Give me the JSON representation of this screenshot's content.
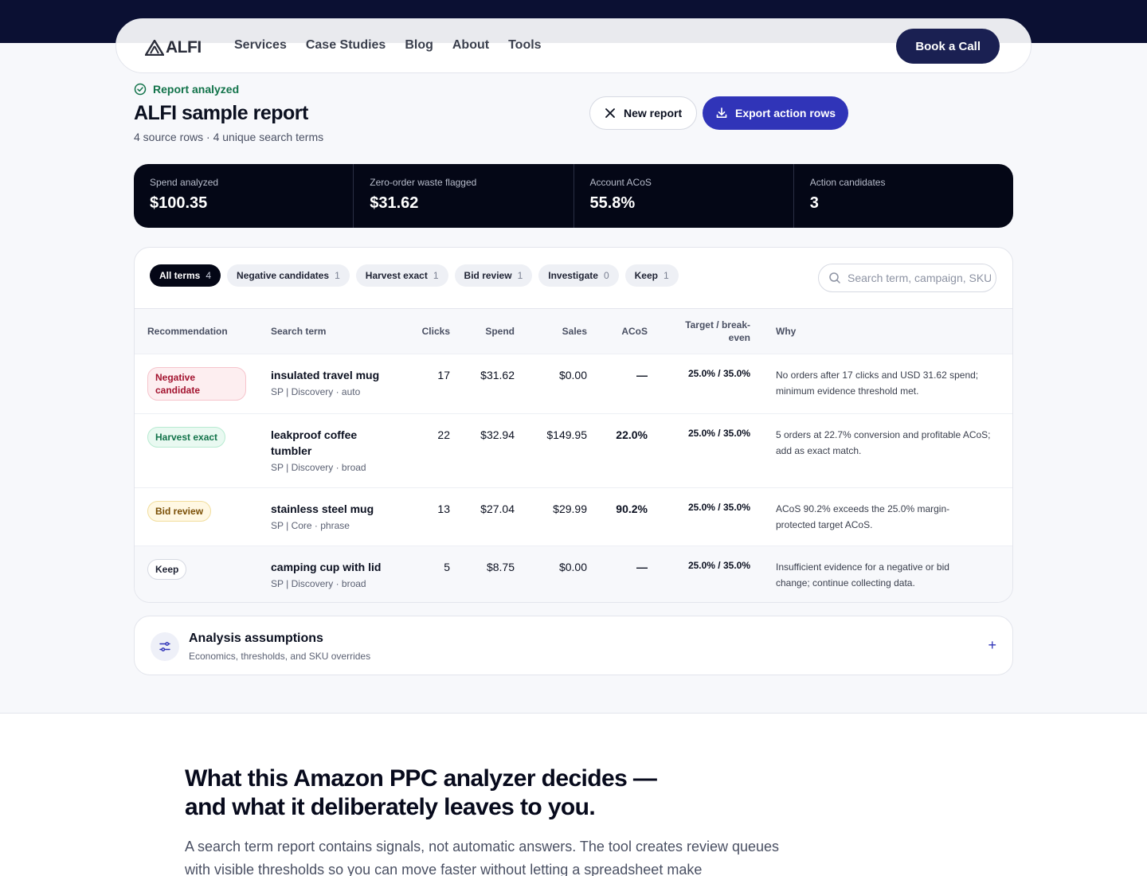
{
  "nav": {
    "logo_text": "ALFI",
    "links": [
      "Services",
      "Case Studies",
      "Blog",
      "About",
      "Tools"
    ],
    "cta": "Book a Call"
  },
  "header": {
    "status": "Report analyzed",
    "title": "ALFI sample report",
    "subtitle": "4 source rows · 4 unique search terms",
    "new_report": "New report",
    "export": "Export action rows"
  },
  "stats": [
    {
      "label": "Spend analyzed",
      "value": "$100.35"
    },
    {
      "label": "Zero-order waste flagged",
      "value": "$31.62"
    },
    {
      "label": "Account ACoS",
      "value": "55.8%"
    },
    {
      "label": "Action candidates",
      "value": "3"
    }
  ],
  "filters": [
    {
      "label": "All terms",
      "count": "4"
    },
    {
      "label": "Negative candidates",
      "count": "1"
    },
    {
      "label": "Harvest exact",
      "count": "1"
    },
    {
      "label": "Bid review",
      "count": "1"
    },
    {
      "label": "Investigate",
      "count": "0"
    },
    {
      "label": "Keep",
      "count": "1"
    }
  ],
  "search": {
    "placeholder": "Search term, campaign, SKU"
  },
  "table": {
    "headers": {
      "recommendation": "Recommendation",
      "term": "Search term",
      "clicks": "Clicks",
      "spend": "Spend",
      "sales": "Sales",
      "acos": "ACoS",
      "target": "Target / break-even",
      "why": "Why"
    },
    "rows": [
      {
        "rec": "Negative candidate",
        "term": "insulated travel mug",
        "meta": "SP | Discovery · auto",
        "clicks": "17",
        "spend": "$31.62",
        "sales": "$0.00",
        "acos": "—",
        "target": "25.0% / 35.0%",
        "why": "No orders after 17 clicks and USD 31.62 spend; minimum evidence threshold met."
      },
      {
        "rec": "Harvest exact",
        "term": "leakproof coffee tumbler",
        "meta": "SP | Discovery · broad",
        "clicks": "22",
        "spend": "$32.94",
        "sales": "$149.95",
        "acos": "22.0%",
        "target": "25.0% / 35.0%",
        "why": "5 orders at 22.7% conversion and profitable ACoS; add as exact match."
      },
      {
        "rec": "Bid review",
        "term": "stainless steel mug",
        "meta": "SP | Core · phrase",
        "clicks": "13",
        "spend": "$27.04",
        "sales": "$29.99",
        "acos": "90.2%",
        "target": "25.0% / 35.0%",
        "why": "ACoS 90.2% exceeds the 25.0% margin-protected target ACoS."
      },
      {
        "rec": "Keep",
        "term": "camping cup with lid",
        "meta": "SP | Discovery · broad",
        "clicks": "5",
        "spend": "$8.75",
        "sales": "$0.00",
        "acos": "—",
        "target": "25.0% / 35.0%",
        "why": "Insufficient evidence for a negative or bid change; continue collecting data."
      }
    ]
  },
  "assumptions": {
    "title": "Analysis assumptions",
    "subtitle": "Economics, thresholds, and SKU overrides",
    "toggle": "+"
  },
  "lower": {
    "title": "What this Amazon PPC analyzer decides —and what it deliberately leaves to you.",
    "body": "A search term report contains signals, not automatic answers. The tool creates review queues with visible thresholds so you can move faster without letting a spreadsheet make"
  },
  "colors": {
    "accent": "#3034b8",
    "dark": "#040716",
    "navy": "#0b1033",
    "success": "#12734a"
  }
}
